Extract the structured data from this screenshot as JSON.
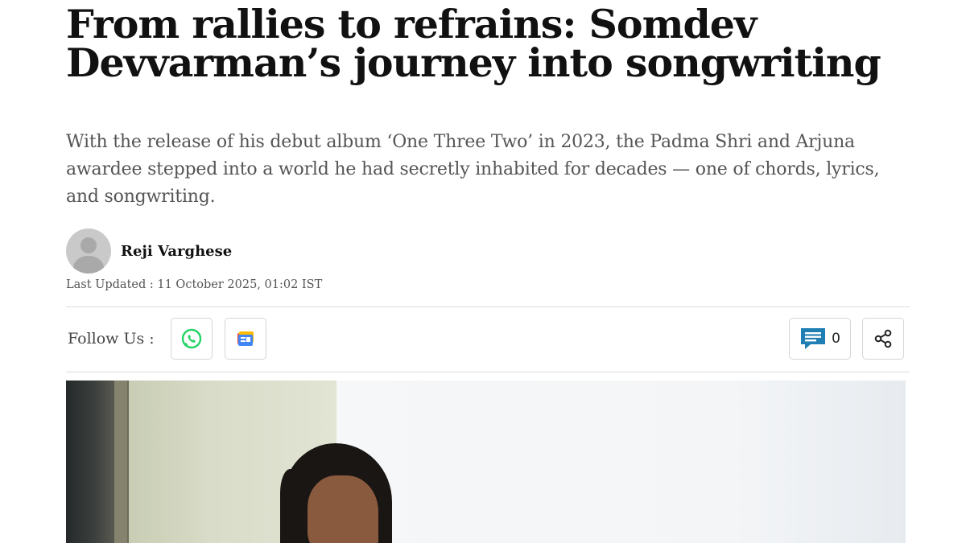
{
  "article": {
    "headline_line1": "From rallies to refrains: Somdev",
    "headline_line2": "Devvarman’s journey into songwriting",
    "dek": "With the release of his debut album ‘One Three Two’ in 2023, the Padma Shri and Arjuna awardee stepped into a world he had secretly inhabited for decades — one of chords, lyrics, and songwriting.",
    "author": "Reji Varghese",
    "last_updated": "Last Updated : 11 October 2025, 01:02 IST"
  },
  "social": {
    "follow_label": "Follow Us :",
    "icons": [
      "whatsapp-icon",
      "google-news-icon"
    ],
    "comment_count": "0",
    "share_icon": "share-icon"
  },
  "colors": {
    "whatsapp": "#25D366",
    "comment": "#1f7fb3",
    "text_muted": "#555555"
  }
}
